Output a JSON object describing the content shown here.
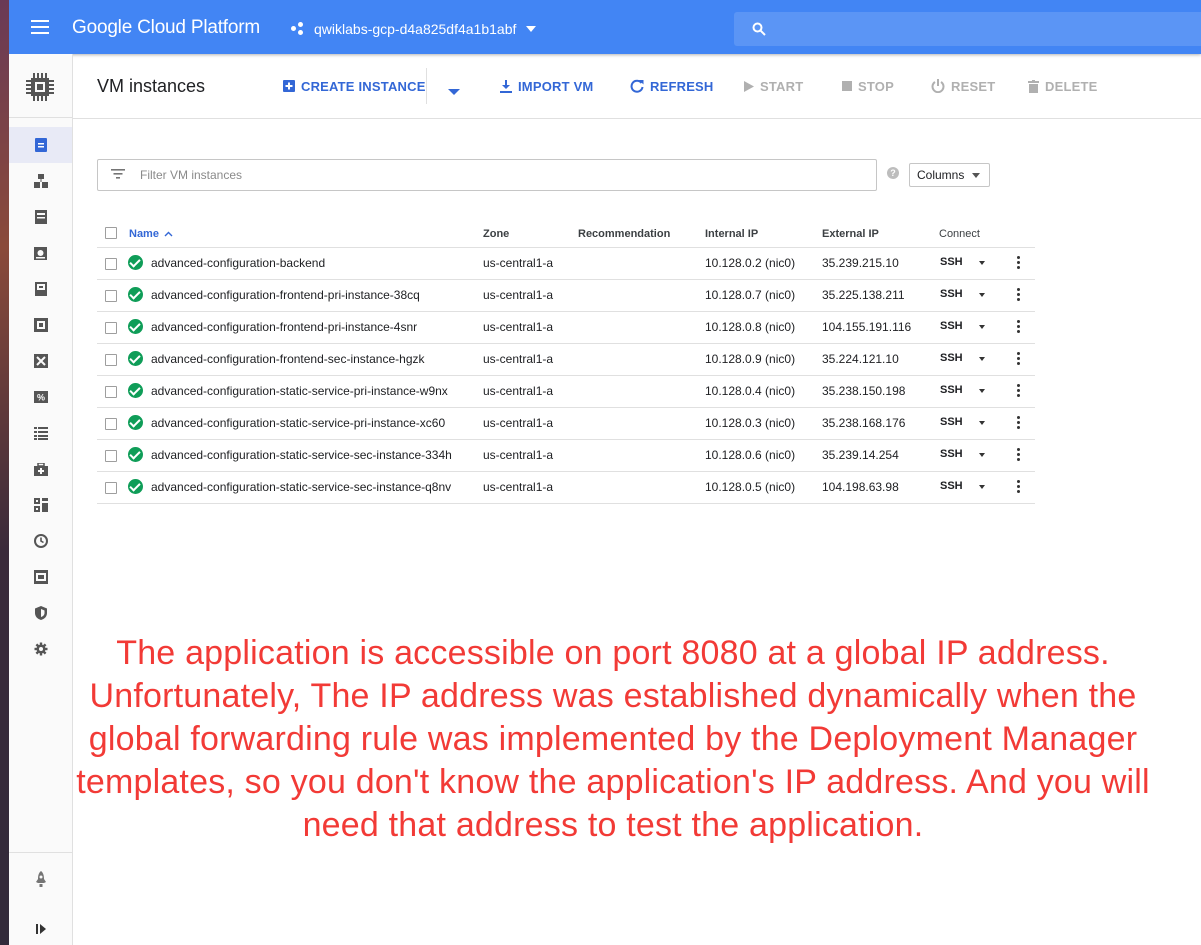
{
  "topbar": {
    "brand": "Google Cloud Platform",
    "project": "qwiklabs-gcp-d4a825df4a1b1abf"
  },
  "header": {
    "title": "VM instances",
    "create_instance": "CREATE INSTANCE",
    "import_vm": "IMPORT VM",
    "refresh": "REFRESH",
    "start": "START",
    "stop": "STOP",
    "reset": "RESET",
    "delete": "DELETE"
  },
  "filter": {
    "placeholder": "Filter VM instances",
    "columns_label": "Columns"
  },
  "table": {
    "headers": {
      "name": "Name",
      "zone": "Zone",
      "recommendation": "Recommendation",
      "internal_ip": "Internal IP",
      "external_ip": "External IP",
      "connect": "Connect"
    },
    "rows": [
      {
        "name": "advanced-configuration-backend",
        "zone": "us-central1-a",
        "internal_ip": "10.128.0.2 (nic0)",
        "external_ip": "35.239.215.10",
        "connect": "SSH"
      },
      {
        "name": "advanced-configuration-frontend-pri-instance-38cq",
        "zone": "us-central1-a",
        "internal_ip": "10.128.0.7 (nic0)",
        "external_ip": "35.225.138.211",
        "connect": "SSH"
      },
      {
        "name": "advanced-configuration-frontend-pri-instance-4snr",
        "zone": "us-central1-a",
        "internal_ip": "10.128.0.8 (nic0)",
        "external_ip": "104.155.191.116",
        "connect": "SSH"
      },
      {
        "name": "advanced-configuration-frontend-sec-instance-hgzk",
        "zone": "us-central1-a",
        "internal_ip": "10.128.0.9 (nic0)",
        "external_ip": "35.224.121.10",
        "connect": "SSH"
      },
      {
        "name": "advanced-configuration-static-service-pri-instance-w9nx",
        "zone": "us-central1-a",
        "internal_ip": "10.128.0.4 (nic0)",
        "external_ip": "35.238.150.198",
        "connect": "SSH"
      },
      {
        "name": "advanced-configuration-static-service-pri-instance-xc60",
        "zone": "us-central1-a",
        "internal_ip": "10.128.0.3 (nic0)",
        "external_ip": "35.238.168.176",
        "connect": "SSH"
      },
      {
        "name": "advanced-configuration-static-service-sec-instance-334h",
        "zone": "us-central1-a",
        "internal_ip": "10.128.0.6 (nic0)",
        "external_ip": "35.239.14.254",
        "connect": "SSH"
      },
      {
        "name": "advanced-configuration-static-service-sec-instance-q8nv",
        "zone": "us-central1-a",
        "internal_ip": "10.128.0.5 (nic0)",
        "external_ip": "104.198.63.98",
        "connect": "SSH"
      }
    ]
  },
  "caption": {
    "lines": [
      "The application is accessible on port 8080 at a global IP address.",
      "Unfortunately, The IP address was established dynamically when the",
      "global forwarding rule was implemented by the Deployment Manager",
      "templates, so you don't know the application's IP address. And you will",
      "need that address to test the application."
    ]
  },
  "colors": {
    "topbar": "#4285f4",
    "action_blue": "#3367d6",
    "status_green": "#0f9d58",
    "caption_red": "#f23a36"
  },
  "icons": {
    "rail": [
      "compute-chip-icon",
      "vm-instances-icon",
      "instance-groups-icon",
      "instance-templates-icon",
      "sole-tenant-nodes-icon",
      "machine-images-icon",
      "tpus-icon",
      "migrate-icon",
      "committed-use-discounts-icon",
      "metadata-icon",
      "health-checks-icon",
      "zones-icon",
      "snapshots-icon",
      "images-icon",
      "security-scans-icon",
      "settings-icon",
      "marketplace-icon",
      "expand-rail-icon"
    ]
  }
}
